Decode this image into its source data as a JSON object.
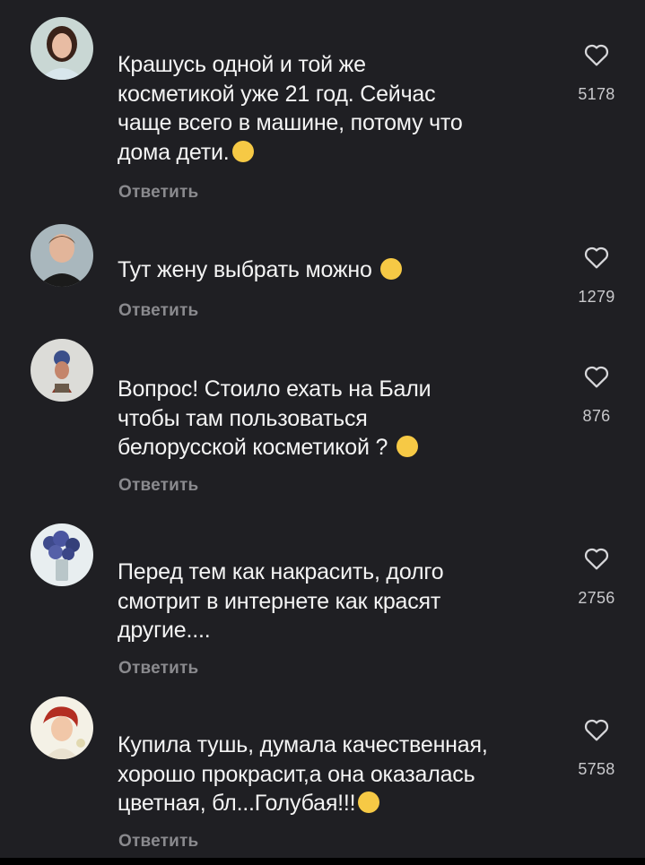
{
  "reply_label": "Ответить",
  "colors": {
    "background": "#1f1f23",
    "text": "#f4f4f4",
    "muted": "#8a8a8e",
    "emoji": "#f6c945"
  },
  "comments": [
    {
      "text": "Крашусь одной и той же\nкосметикой уже 21 год. Сейчас\nчаще всего в машине, потому что\nдома дети.",
      "emoji": "tears-of-joy-emoji",
      "likes": "5178",
      "avatar": "woman-portrait"
    },
    {
      "text": "Тут жену выбрать можно ",
      "emoji": "tears-of-joy-emoji",
      "likes": "1279",
      "avatar": "man-portrait"
    },
    {
      "text": "Вопрос! Стоило ехать на Бали\nчтобы  там пользоваться\nбелорусской косметикой ? ",
      "emoji": "eye-roll-emoji",
      "likes": "876",
      "avatar": "art-figure"
    },
    {
      "text": "Перед тем как накрасить, долго\nсмотрит в интернете как красят\nдругие....",
      "emoji": "",
      "likes": "2756",
      "avatar": "lavender-flowers"
    },
    {
      "text": "Купила тушь, думала качественная,\nхорошо прокрасит,а она оказалась\nцветная, бл...Голубая!!!",
      "emoji": "sweat-smile-emoji",
      "likes": "5758",
      "avatar": "retro-woman"
    }
  ]
}
